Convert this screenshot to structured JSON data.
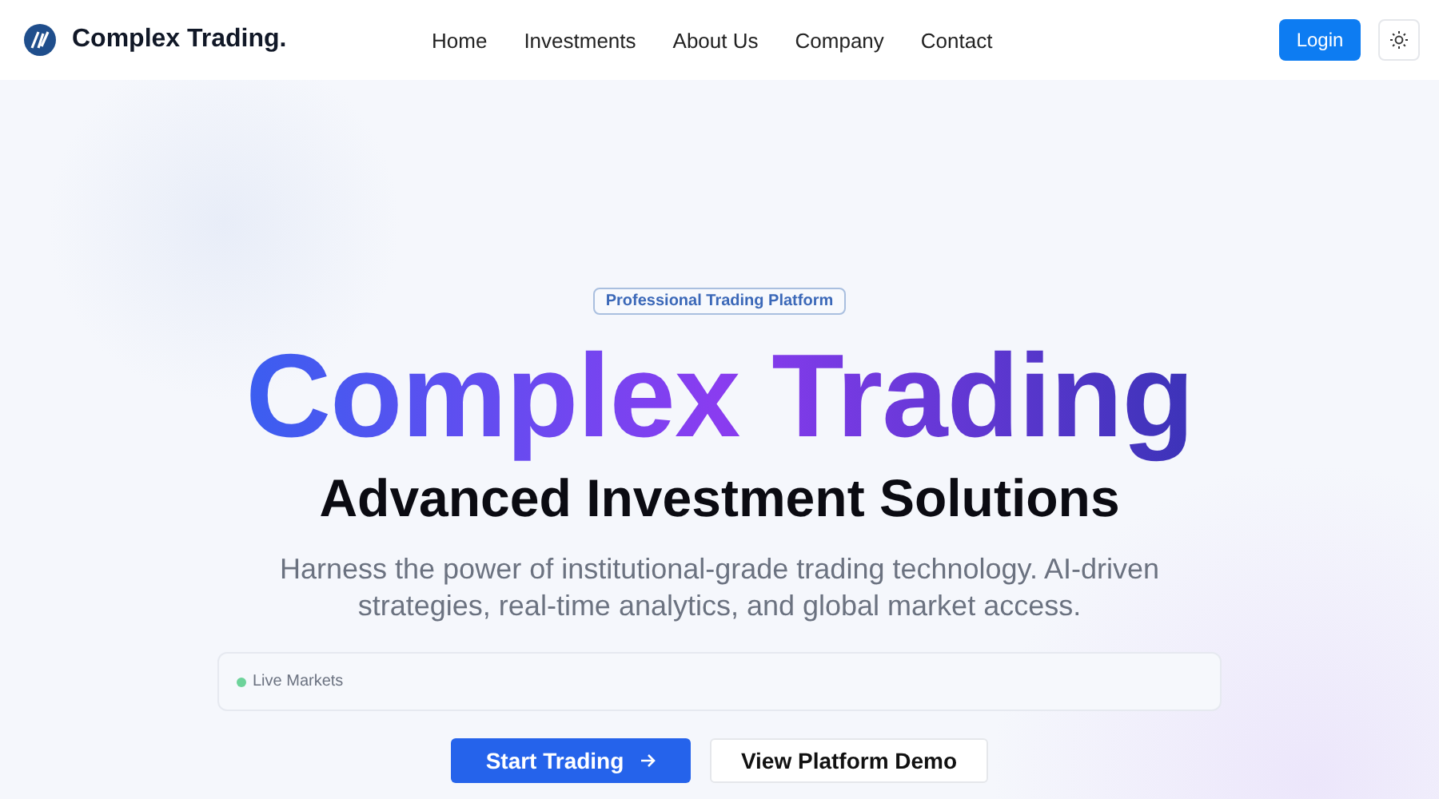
{
  "header": {
    "brand": "Complex Trading.",
    "nav": [
      {
        "label": "Home"
      },
      {
        "label": "Investments"
      },
      {
        "label": "About Us"
      },
      {
        "label": "Company"
      },
      {
        "label": "Contact"
      }
    ],
    "login": "Login"
  },
  "hero": {
    "badge": "Professional Trading Platform",
    "title": "Complex Trading",
    "subtitle": "Advanced Investment Solutions",
    "description": "Harness the power of institutional-grade trading technology. AI-driven strategies, real-time analytics, and global market access.",
    "ticker": {
      "label": "Live Markets",
      "live": true
    },
    "buttons": [
      {
        "label": "Start Trading",
        "kind": "primary"
      },
      {
        "label": "View Platform Demo",
        "kind": "secondary"
      }
    ]
  }
}
